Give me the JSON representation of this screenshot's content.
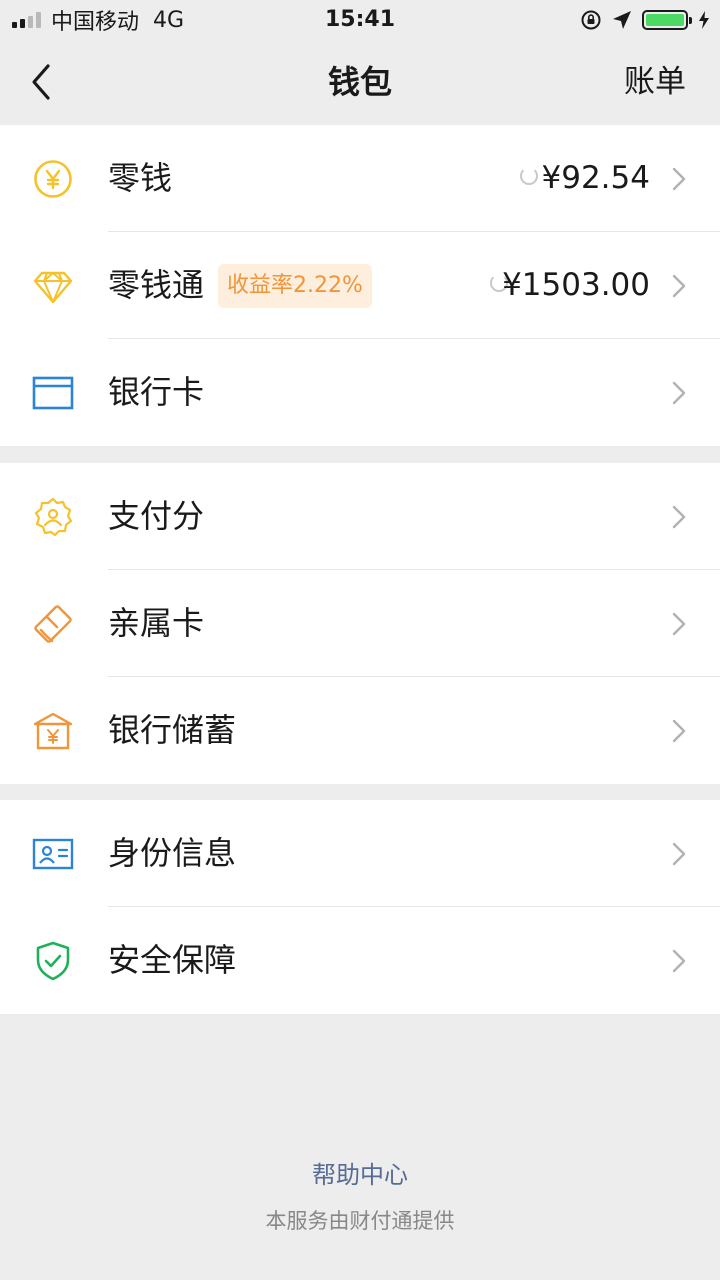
{
  "status_bar": {
    "carrier": "中国移动",
    "network": "4G",
    "time": "15:41"
  },
  "nav": {
    "title": "钱包",
    "action": "账单"
  },
  "group1": [
    {
      "label": "零钱",
      "amount": "¥92.54",
      "icon": "yen-coin-icon"
    },
    {
      "label": "零钱通",
      "badge": "收益率2.22%",
      "amount": "¥1503.00",
      "icon": "diamond-icon"
    },
    {
      "label": "银行卡",
      "icon": "bank-card-icon"
    }
  ],
  "group2": [
    {
      "label": "支付分",
      "icon": "pay-score-badge-icon"
    },
    {
      "label": "亲属卡",
      "icon": "family-card-icon"
    },
    {
      "label": "银行储蓄",
      "icon": "bank-savings-icon"
    }
  ],
  "group3": [
    {
      "label": "身份信息",
      "icon": "id-card-icon"
    },
    {
      "label": "安全保障",
      "icon": "security-shield-icon"
    }
  ],
  "footer": {
    "help": "帮助中心",
    "provider": "本服务由财付通提供"
  },
  "colors": {
    "yellow": "#f5c22c",
    "orange": "#f0953a",
    "blue": "#2a84d8",
    "green": "#20b05b",
    "link": "#576b95",
    "battery": "#4cd964"
  }
}
